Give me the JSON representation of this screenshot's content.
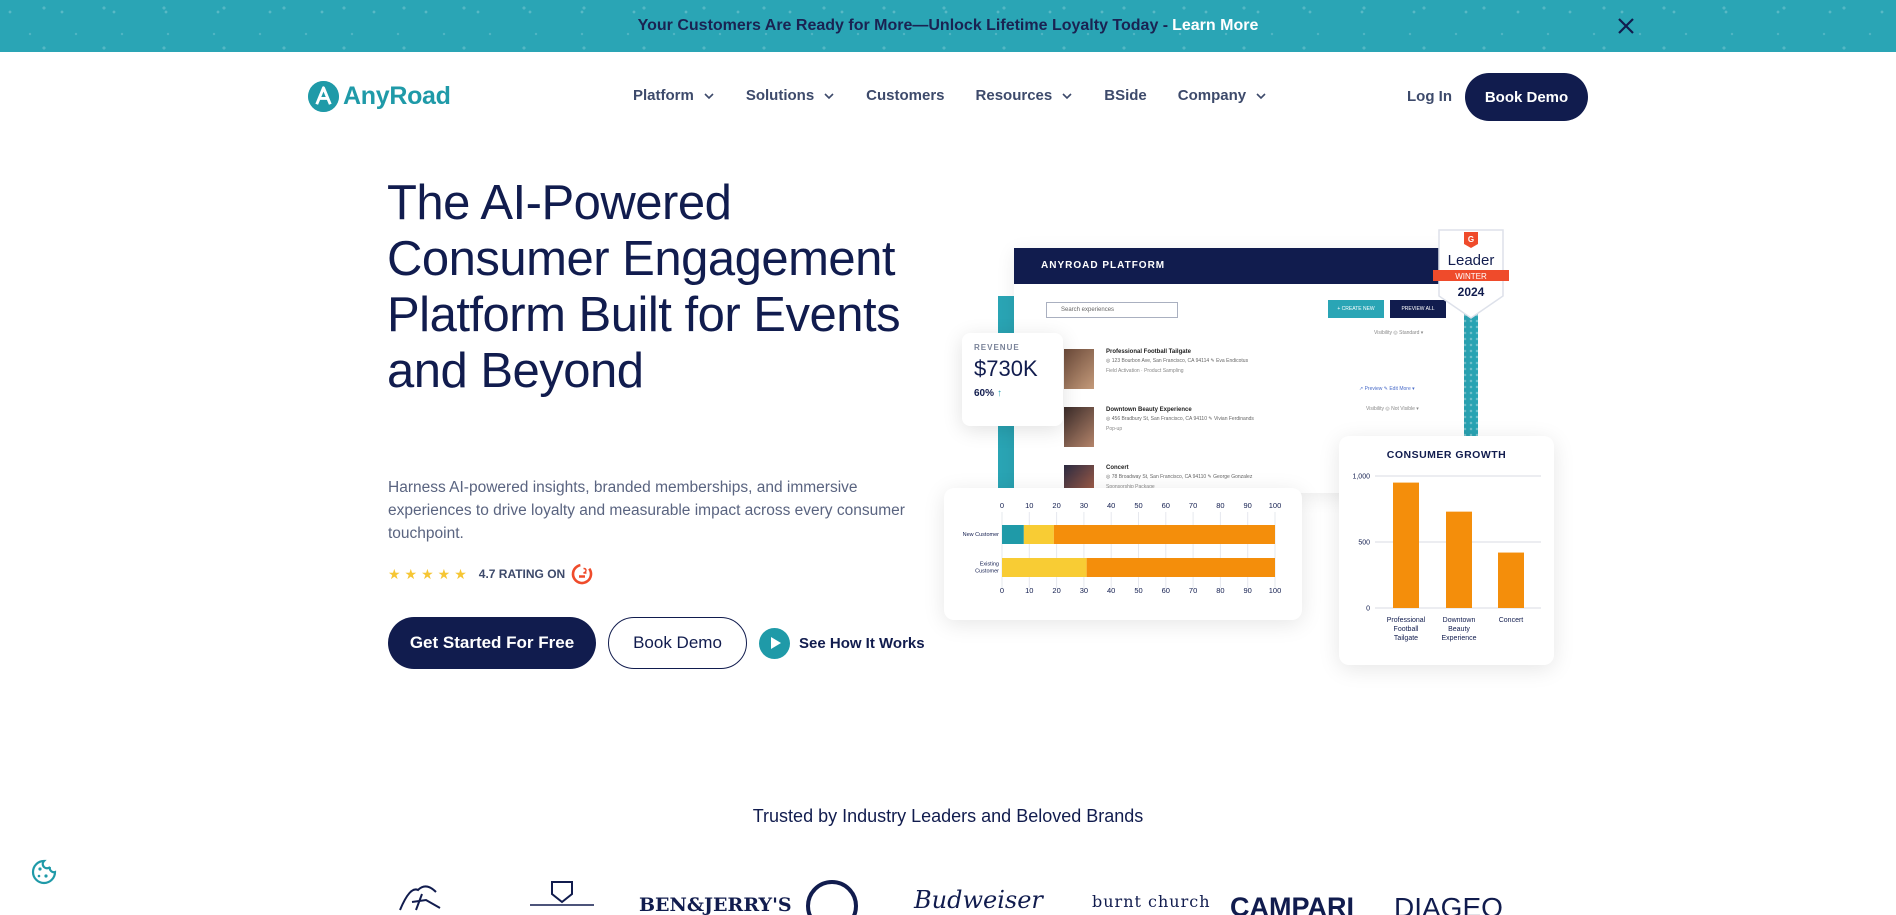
{
  "announcement": {
    "text": "Your Customers Are Ready for More—Unlock Lifetime Loyalty Today -",
    "link": "Learn More",
    "close_icon": "close-icon"
  },
  "header": {
    "logo_text": "AnyRoad",
    "nav": [
      {
        "label": "Platform",
        "dropdown": true
      },
      {
        "label": "Solutions",
        "dropdown": true
      },
      {
        "label": "Customers",
        "dropdown": false
      },
      {
        "label": "Resources",
        "dropdown": true
      },
      {
        "label": "BSide",
        "dropdown": false
      },
      {
        "label": "Company",
        "dropdown": true
      }
    ],
    "login": "Log In",
    "book_demo": "Book Demo"
  },
  "hero": {
    "title": "The AI-Powered Consumer Engagement Platform Built for Events and Beyond",
    "subtitle": "Harness AI-powered insights, branded memberships, and immersive experiences to drive loyalty and measurable impact across every consumer touchpoint.",
    "rating_stars": "★★★★★",
    "rating_text": "4.7 RATING ON",
    "cta_primary": "Get Started For Free",
    "cta_secondary": "Book Demo",
    "cta_video": "See How It Works"
  },
  "dashboard": {
    "header": "ANYROAD PLATFORM",
    "search_placeholder": "Search experiences",
    "btn_create": "+ CREATE NEW",
    "btn_preview": "PREVIEW ALL",
    "visibility_1": "Visibility  ◎ Standard ▾",
    "visibility_2": "Visibility  ◎ Not Visible ▾",
    "row_actions": "↗ Preview   ✎ Edit   More ▾",
    "rows": [
      {
        "title": "Professional Football Tailgate",
        "meta": "◎ 123 Bourbon Ave, San Francisco, CA 94114   ✎ Eva Endicotus",
        "host": "Field Activation · Product Sampling"
      },
      {
        "title": "Downtown Beauty Experience",
        "meta": "◎ 456 Bradbury St, San Francisco, CA 94110   ✎ Vivian Ferdinands",
        "host": "Pop-up"
      },
      {
        "title": "Concert",
        "meta": "◎ 78 Broadway St, San Francisco, CA 94110   ✎ George Gonzalez",
        "host": "Sponsorship Package"
      }
    ],
    "revenue_label": "REVENUE",
    "revenue_value": "$730K",
    "revenue_pct": "60%",
    "revenue_arrow": "↑",
    "badge": {
      "title": "Leader",
      "ribbon": "WINTER",
      "year": "2024"
    }
  },
  "hbar_chart": {
    "type": "bar",
    "orientation": "horizontal",
    "stacked": true,
    "categories": [
      "New Customer",
      "Existing Customer"
    ],
    "category_lines": [
      [
        "New Customer"
      ],
      [
        "Existing",
        "Customer"
      ]
    ],
    "ticks": [
      "0",
      "10",
      "20",
      "30",
      "40",
      "50",
      "60",
      "70",
      "80",
      "90",
      "100"
    ],
    "xlim": [
      0,
      100
    ],
    "segments": [
      [
        8,
        11,
        81
      ],
      [
        0,
        31,
        69
      ]
    ],
    "colors": [
      "#1f9aa8",
      "#f8cc34",
      "#f48e0b"
    ]
  },
  "chart_data": {
    "type": "bar",
    "title": "CONSUMER GROWTH",
    "categories": [
      "Professional Football Tailgate",
      "Downtown Beauty Experience",
      "Concert"
    ],
    "category_lines": [
      [
        "Professional",
        "Football",
        "Tailgate"
      ],
      [
        "Downtown",
        "Beauty",
        "Experience"
      ],
      [
        "Concert"
      ]
    ],
    "values": [
      950,
      730,
      420
    ],
    "ylim": [
      0,
      1000
    ],
    "yticks": [
      "1,000",
      "500",
      "0"
    ],
    "color": "#f48e0b"
  },
  "trusted": {
    "heading": "Trusted by Industry Leaders and Beloved Brands",
    "brands": [
      "BEN&JERRY'S",
      "Budweiser",
      "burnt church",
      "CAMPARI",
      "DIAGEO"
    ]
  },
  "colors": {
    "navy": "#111c4e",
    "teal": "#2aa5b5",
    "orange": "#f48e0b",
    "yellow": "#f8cc34"
  }
}
